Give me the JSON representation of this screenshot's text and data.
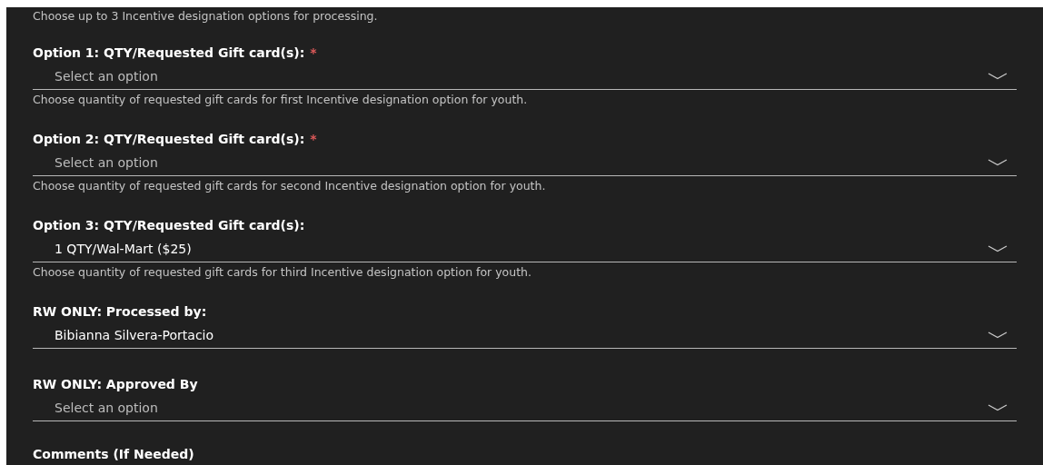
{
  "intro": "Choose up to 3 Incentive designation options for processing.",
  "fields": [
    {
      "label": "Option 1: QTY/Requested Gift card(s):",
      "required": true,
      "placeholder": "Select an option",
      "hint": "Choose quantity of requested gift cards for first Incentive designation option for youth."
    },
    {
      "label": "Option 2: QTY/Requested Gift card(s):",
      "required": true,
      "placeholder": "Select an option",
      "hint": "Choose quantity of requested gift cards for second Incentive designation option for youth."
    },
    {
      "label": "Option 3: QTY/Requested Gift card(s):",
      "required": false,
      "value": "1 QTY/Wal-Mart ($25)",
      "hint": "Choose quantity of requested gift cards for third Incentive designation option for youth."
    },
    {
      "label": "RW ONLY: Processed by:",
      "required": false,
      "value": "Bibianna Silvera-Portacio"
    },
    {
      "label": "RW ONLY: Approved By",
      "required": false,
      "placeholder": "Select an option"
    }
  ],
  "required_mark": "*",
  "comments_label": "Comments (If Needed)"
}
